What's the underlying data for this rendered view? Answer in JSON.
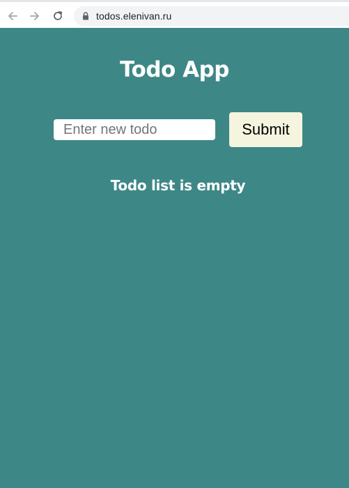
{
  "browser": {
    "url": "todos.elenivan.ru",
    "back_icon": "arrow-left-icon",
    "forward_icon": "arrow-right-icon",
    "reload_icon": "reload-icon",
    "lock_icon": "lock-icon"
  },
  "app": {
    "title": "Todo App",
    "input_placeholder": "Enter new todo",
    "input_value": "",
    "submit_label": "Submit",
    "empty_message": "Todo list is empty"
  },
  "colors": {
    "page_background": "#3d8787",
    "submit_background": "#f5f4df",
    "heading_text": "#ffffff"
  }
}
